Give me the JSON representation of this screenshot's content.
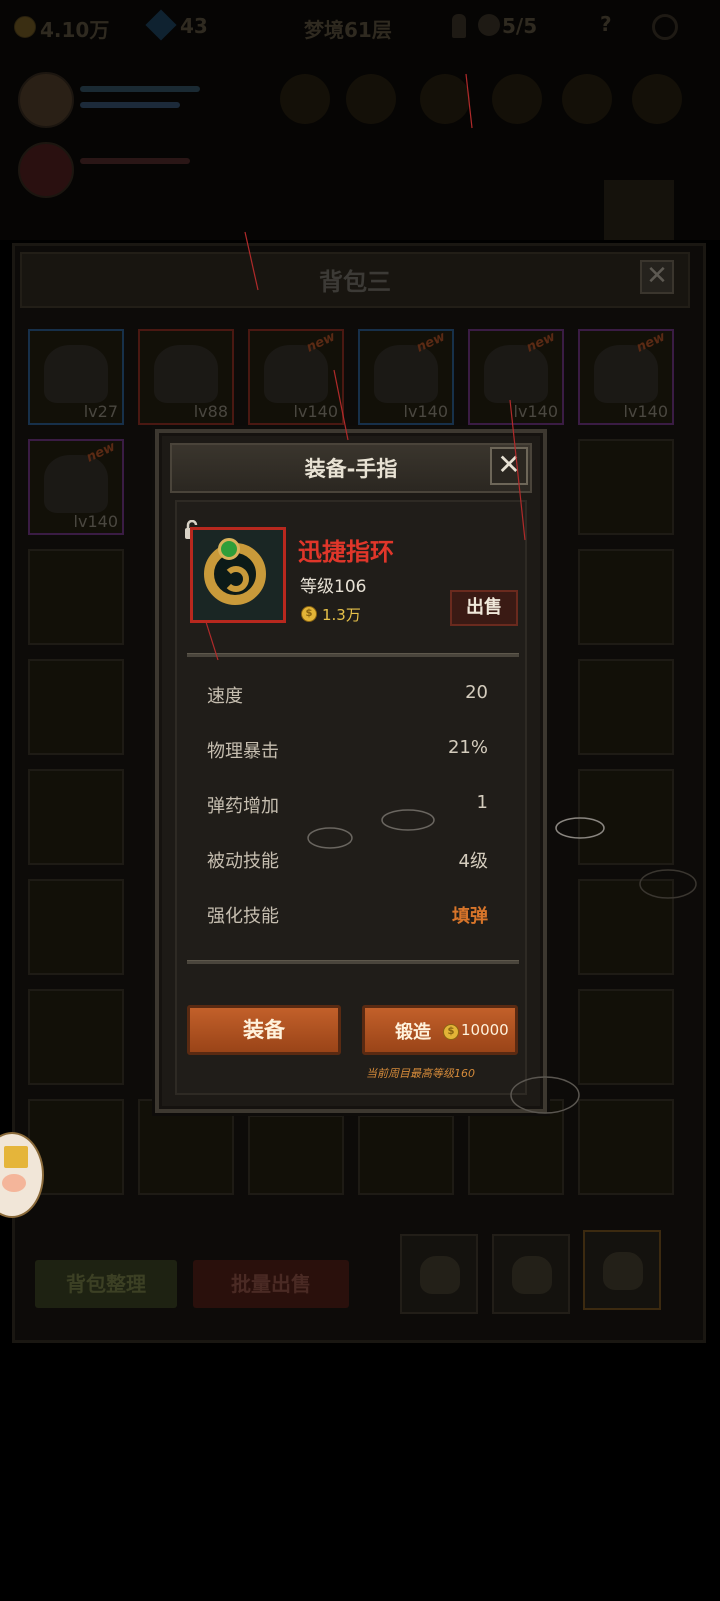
{
  "hud": {
    "gold": "4.10万",
    "gems": "43",
    "stage": "梦境61层",
    "keys": "5/5"
  },
  "bag": {
    "title": "背包三",
    "close_glyph": "✕",
    "items": [
      {
        "level": "lv27",
        "new": "",
        "rarity": "blue"
      },
      {
        "level": "lv88",
        "new": "",
        "rarity": "red"
      },
      {
        "level": "lv140",
        "new": "new",
        "rarity": "red"
      },
      {
        "level": "lv140",
        "new": "new",
        "rarity": "blue"
      },
      {
        "level": "lv140",
        "new": "new",
        "rarity": "purple"
      },
      {
        "level": "lv140",
        "new": "new",
        "rarity": "purple"
      },
      {
        "level": "lv140",
        "new": "new",
        "rarity": "purple"
      }
    ],
    "sort_label": "背包整理",
    "bulk_sell_label": "批量出售"
  },
  "modal": {
    "title": "装备-手指",
    "close_glyph": "✕",
    "item": {
      "name": "迅捷指环",
      "level": "等级106",
      "price": "1.3万",
      "sell_label": "出售",
      "icon": "ring-icon"
    },
    "stats": [
      {
        "label": "速度",
        "value": "20",
        "highlight": false
      },
      {
        "label": "物理暴击",
        "value": "21%",
        "highlight": false
      },
      {
        "label": "弹药增加",
        "value": "1",
        "highlight": false
      },
      {
        "label": "被动技能",
        "value": "4级",
        "highlight": false
      },
      {
        "label": "强化技能",
        "value": "填弹",
        "highlight": true
      }
    ],
    "equip_label": "装备",
    "forge_label": "锻造",
    "forge_cost": "10000",
    "max_level_note": "当前周目最高等级160"
  },
  "colors": {
    "item_name": "#e0362a",
    "button": "#b0532a",
    "highlight_value": "#d8752a",
    "coin": "#e3b437"
  }
}
